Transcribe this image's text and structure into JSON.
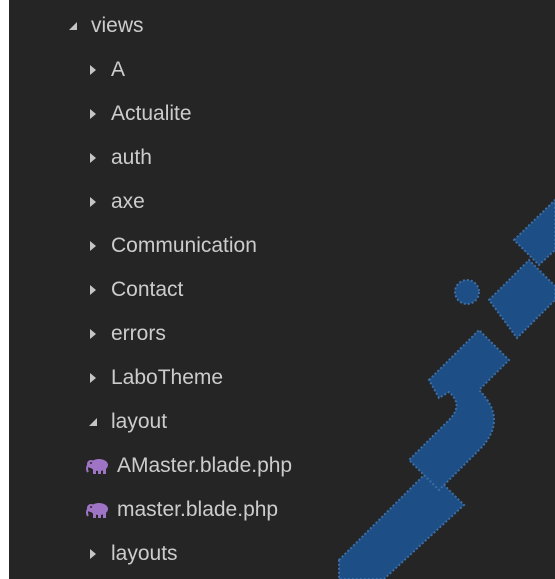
{
  "explorer": {
    "colors": {
      "background": "#252526",
      "text": "#cccccc",
      "twistie": "#c5c5c5",
      "php_icon": "#a074c4",
      "watermark": "#1d4f86"
    },
    "root": {
      "label": "views",
      "state": "expanded"
    },
    "folders": [
      {
        "label": "A",
        "state": "collapsed"
      },
      {
        "label": "Actualite",
        "state": "collapsed"
      },
      {
        "label": "auth",
        "state": "collapsed"
      },
      {
        "label": "axe",
        "state": "collapsed"
      },
      {
        "label": "Communication",
        "state": "collapsed"
      },
      {
        "label": "Contact",
        "state": "collapsed"
      },
      {
        "label": "errors",
        "state": "collapsed"
      },
      {
        "label": "LaboTheme",
        "state": "collapsed"
      }
    ],
    "layout_folder": {
      "label": "layout",
      "state": "expanded",
      "files": [
        {
          "label": "AMaster.blade.php",
          "icon": "php-elephant-icon"
        },
        {
          "label": "master.blade.php",
          "icon": "php-elephant-icon"
        }
      ]
    },
    "last_folder": {
      "label": "layouts",
      "state": "collapsed"
    }
  }
}
